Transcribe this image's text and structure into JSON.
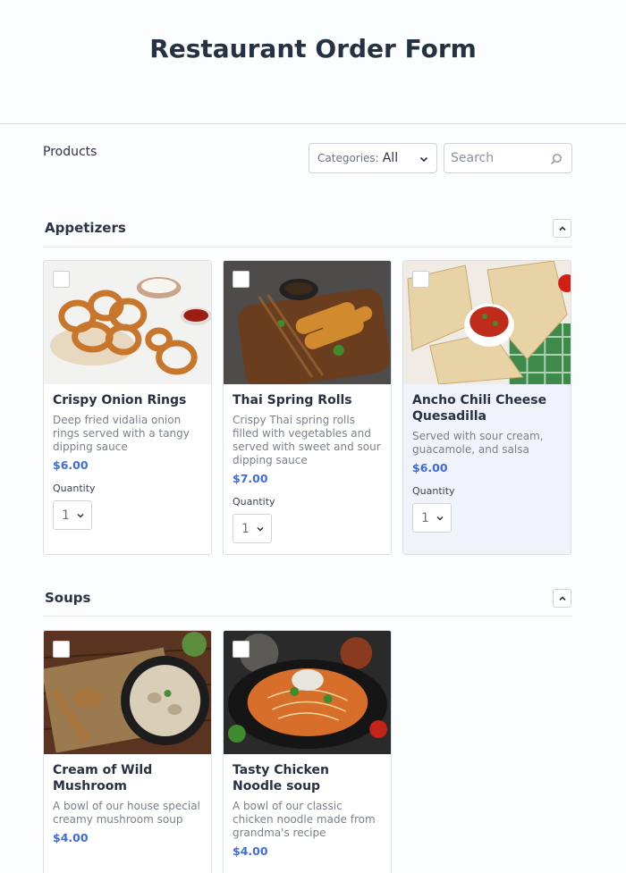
{
  "page": {
    "title": "Restaurant Order Form"
  },
  "toolbar": {
    "products_label": "Products",
    "category_prefix": "Categories:",
    "category_value": "All",
    "search_placeholder": "Search"
  },
  "sections": [
    {
      "title": "Appetizers",
      "items": [
        {
          "name": "Crispy Onion Rings",
          "description": "Deep fried vidalia onion rings served with a tangy dipping sauce",
          "price": "$6.00",
          "quantity_label": "Quantity",
          "quantity": "1"
        },
        {
          "name": "Thai Spring Rolls",
          "description": "Crispy Thai spring rolls filled with vegetables and served with sweet and sour dipping sauce",
          "price": "$7.00",
          "quantity_label": "Quantity",
          "quantity": "1"
        },
        {
          "name": "Ancho Chili Cheese Quesadilla",
          "description": "Served with sour cream, guacamole, and salsa",
          "price": "$6.00",
          "quantity_label": "Quantity",
          "quantity": "1"
        }
      ]
    },
    {
      "title": "Soups",
      "items": [
        {
          "name": "Cream of Wild Mushroom",
          "description": "A bowl of our house special creamy mushroom soup",
          "price": "$4.00"
        },
        {
          "name": "Tasty Chicken Noodle soup",
          "description": "A bowl of our classic chicken noodle made from grandma's recipe",
          "price": "$4.00"
        }
      ]
    }
  ],
  "colors": {
    "accent": "#3f6be0",
    "title": "#263141",
    "highlight_card": "#f1f3fb"
  }
}
